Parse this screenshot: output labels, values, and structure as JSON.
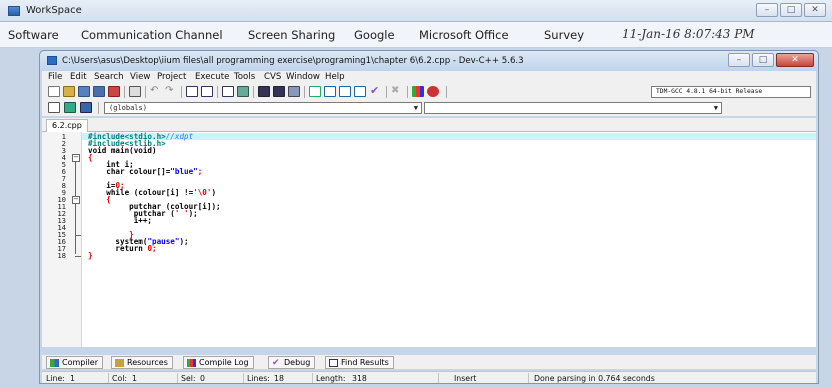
{
  "workspace": {
    "title": "WorkSpace",
    "menu": [
      "Software",
      "Communication Channel",
      "Screen Sharing",
      "Google",
      "Microsoft Office",
      "Survey"
    ],
    "clock": "11-Jan-16 8:07:43 PM"
  },
  "devcpp": {
    "title": "C:\\Users\\asus\\Desktop\\iium files\\all programming exercise\\programing1\\chapter 6\\6.2.cpp - Dev-C++ 5.6.3",
    "menu": [
      "File",
      "Edit",
      "Search",
      "View",
      "Project",
      "Execute",
      "Tools",
      "CVS",
      "Window",
      "Help"
    ],
    "compiler_select": "TDM-GCC 4.8.1 64-bit Release",
    "scope_select": "(globals)",
    "file_tab": "6.2.cpp",
    "line_numbers": [
      "1",
      "2",
      "3",
      "4",
      "5",
      "6",
      "7",
      "8",
      "9",
      "10",
      "11",
      "12",
      "13",
      "14",
      "15",
      "16",
      "17",
      "18"
    ],
    "code": {
      "l1": "#include<stdio.h>",
      "l1_comment": "//xdpt",
      "l2": "#include<stlib.h>",
      "l3": "void main(void)",
      "l4": "{",
      "l5": "    int i;",
      "l6a": "    char colour[]=",
      "l6b": "\"blue\"",
      "l6c": ";",
      "l8a": "    i=",
      "l8b": "0",
      "l8c": ";",
      "l9a": "    while (colour[i] !=",
      "l9b": "'\\0'",
      "l9c": ")",
      "l10": "    {",
      "l11a": "         putchar (colour[i]);",
      "l12a": "          putchar (",
      "l12b": "' '",
      "l12c": ");",
      "l13": "          i++;",
      "l15": "         }",
      "l16a": "      system(",
      "l16b": "\"pause\"",
      "l16c": ");",
      "l17a": "      return ",
      "l17b": "0",
      "l17c": ";",
      "l18": "}"
    },
    "bottom_tabs": [
      "Compiler",
      "Resources",
      "Compile Log",
      "Debug",
      "Find Results"
    ],
    "status": {
      "line_label": "Line:",
      "line_value": "1",
      "col_label": "Col:",
      "col_value": "1",
      "sel_label": "Sel:",
      "sel_value": "0",
      "lines_label": "Lines:",
      "lines_value": "18",
      "length_label": "Length:",
      "length_value": "318",
      "mode": "Insert",
      "message": "Done parsing in 0.764 seconds"
    }
  }
}
